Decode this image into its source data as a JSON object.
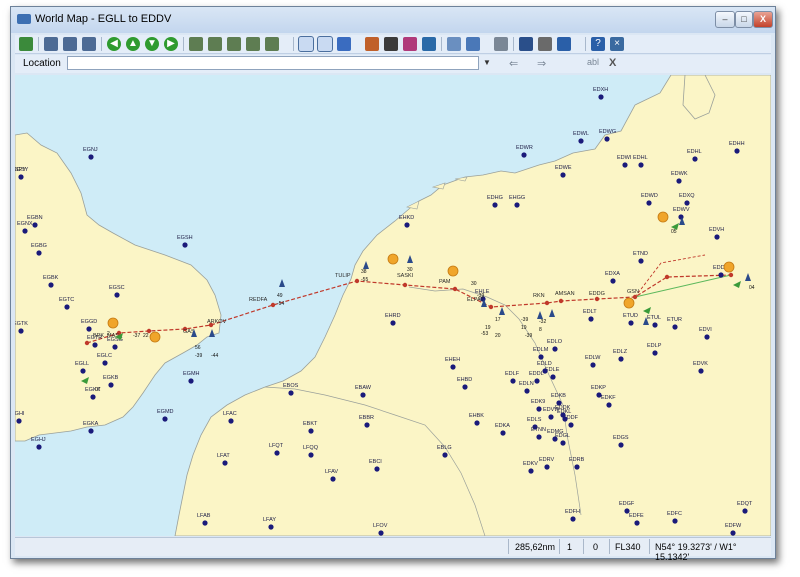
{
  "window": {
    "title": "World Map - EGLL to EDDV",
    "minimize": "–",
    "maximize": "□",
    "close": "X"
  },
  "toolbar": {
    "buttons": [
      "refresh",
      "zoom-in",
      "zoom-out",
      "zoom-fit",
      "nav-left",
      "nav-up",
      "nav-down",
      "nav-right",
      "zoom-region",
      "zoom-airport",
      "zoom-route",
      "zoom-window",
      "zoom-all",
      "select-tool",
      "draw-tool",
      "aircraft",
      "terrain",
      "weather",
      "airspace",
      "waypoints",
      "routes",
      "settings",
      "pan",
      "print",
      "save",
      "export",
      "help",
      "close"
    ]
  },
  "location": {
    "label": "Location",
    "value": "",
    "back": "⇐",
    "forward": "⇒",
    "clear": "X",
    "abl": "abl"
  },
  "map": {
    "colors": {
      "sea": "#cfecf7",
      "land": "#fbf5c6",
      "border": "#9aa09a",
      "route": "#c0392b",
      "route_green": "#5cb85c",
      "airport": "#1a1a7a"
    },
    "airports": [
      {
        "n": "EDXH"
      },
      {
        "n": "EGNJ"
      },
      {
        "n": "EDWR"
      },
      {
        "n": "EDHH"
      },
      {
        "n": "EDHL"
      },
      {
        "n": "EDWG"
      },
      {
        "n": "EDWL"
      },
      {
        "n": "EDWI"
      },
      {
        "n": "EDWE"
      },
      {
        "n": "EDWK"
      },
      {
        "n": "EDHG"
      },
      {
        "n": "EHGG"
      },
      {
        "n": "EHKD"
      },
      {
        "n": "EDXQ"
      },
      {
        "n": "EDWV"
      },
      {
        "n": "EDVH"
      },
      {
        "n": "EDWD"
      },
      {
        "n": "EDHL"
      },
      {
        "n": "EGSY"
      },
      {
        "n": "EGBN"
      },
      {
        "n": "EGNX"
      },
      {
        "n": "EGBG"
      },
      {
        "n": "EGSH"
      },
      {
        "n": "EGBK"
      },
      {
        "n": "EGSC"
      },
      {
        "n": "EGTC"
      },
      {
        "n": "EGGD"
      },
      {
        "n": "EGTK"
      },
      {
        "n": "EGTR"
      },
      {
        "n": "EGSG"
      },
      {
        "n": "EGLC"
      },
      {
        "n": "EGLL"
      },
      {
        "n": "EGKB"
      },
      {
        "n": "EGMH"
      },
      {
        "n": "EGKK"
      },
      {
        "n": "EGMD"
      },
      {
        "n": "EGKA"
      },
      {
        "n": "EGHI"
      },
      {
        "n": "EGHJ"
      },
      {
        "n": "EBOS"
      },
      {
        "n": "EBAW"
      },
      {
        "n": "EBBR"
      },
      {
        "n": "EBKT"
      },
      {
        "n": "EBCI"
      },
      {
        "n": "EBLG"
      },
      {
        "n": "EHBK"
      },
      {
        "n": "EHRD"
      },
      {
        "n": "EHEH"
      },
      {
        "n": "EHBD"
      },
      {
        "n": "EHLE"
      },
      {
        "n": "EDLE"
      },
      {
        "n": "EDLN"
      },
      {
        "n": "EDLF"
      },
      {
        "n": "EDDL"
      },
      {
        "n": "EDLW"
      },
      {
        "n": "EDLZ"
      },
      {
        "n": "EDLP"
      },
      {
        "n": "EDLT"
      },
      {
        "n": "EDVK"
      },
      {
        "n": "EDVI"
      },
      {
        "n": "EDXA"
      },
      {
        "n": "ETND"
      },
      {
        "n": "EDKP"
      },
      {
        "n": "EDKF"
      },
      {
        "n": "EDKB"
      },
      {
        "n": "EDK9"
      },
      {
        "n": "EDLS"
      },
      {
        "n": "EDKA"
      },
      {
        "n": "ETNN"
      },
      {
        "n": "EDGS"
      },
      {
        "n": "EDKV"
      },
      {
        "n": "EDRV"
      },
      {
        "n": "EDRB"
      },
      {
        "n": "EDFH"
      },
      {
        "n": "EDGF"
      },
      {
        "n": "EDFE"
      },
      {
        "n": "EDFC"
      },
      {
        "n": "EDFW"
      },
      {
        "n": "EDQT"
      },
      {
        "n": "LFAT"
      },
      {
        "n": "LFQT"
      },
      {
        "n": "LFQQ"
      },
      {
        "n": "LFAV"
      },
      {
        "n": "LFAB"
      },
      {
        "n": "LFAY"
      },
      {
        "n": "LFOV"
      },
      {
        "n": "LFAC"
      },
      {
        "n": "EDDV"
      },
      {
        "n": "ETUD"
      },
      {
        "n": "ETUL"
      },
      {
        "n": "ETUR"
      },
      {
        "n": "EDDF"
      },
      {
        "n": "EDDK"
      },
      {
        "n": "EDVW"
      },
      {
        "n": "EDMG"
      },
      {
        "n": "EDKL"
      },
      {
        "n": "EDGL"
      },
      {
        "n": "EDLM"
      },
      {
        "n": "EDLD"
      },
      {
        "n": "EDLO"
      }
    ],
    "waypoints": [
      {
        "n": "REDFA"
      },
      {
        "n": "TULIP"
      },
      {
        "n": "SASKI"
      },
      {
        "n": "PAM"
      },
      {
        "n": "ELPAT"
      },
      {
        "n": "RKN"
      },
      {
        "n": "AMSAN"
      },
      {
        "n": "EDDG"
      },
      {
        "n": "GSN"
      },
      {
        "n": "SPY"
      },
      {
        "n": "ARKOV"
      },
      {
        "n": "BPK"
      },
      {
        "n": "MAS"
      },
      {
        "n": "GAS"
      }
    ],
    "wind_labels": [
      "49",
      "-54",
      "38",
      "-55",
      "30",
      "30",
      "-39",
      "19",
      "17",
      "-32",
      "8",
      "-39",
      "19",
      "-53",
      "20",
      "-39",
      "56",
      "-39",
      "-44",
      "07",
      "05",
      "04",
      "2",
      "-37",
      "22"
    ]
  },
  "status": {
    "distance": "285,62nm",
    "count1": "1",
    "count2": "0",
    "level": "FL340",
    "position": "N54° 19.3273' / W1° 15.1342'"
  }
}
